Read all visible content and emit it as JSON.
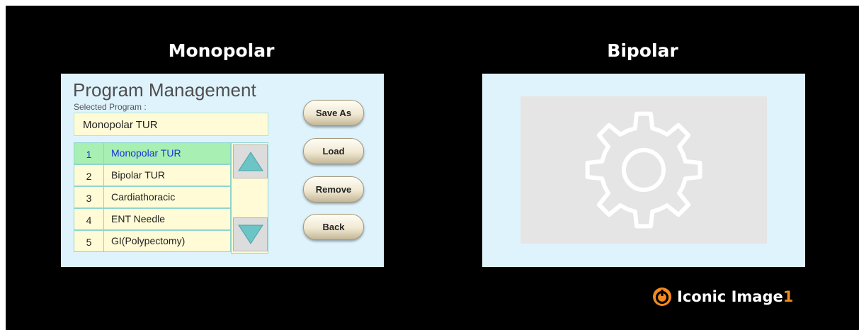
{
  "monopolar": {
    "heading": "Monopolar",
    "title": "Program Management",
    "selected_label": "Selected Program :",
    "selected_value": "Monopolar TUR",
    "programs": [
      {
        "num": "1",
        "name": "Monopolar TUR",
        "active": true
      },
      {
        "num": "2",
        "name": "Bipolar TUR",
        "active": false
      },
      {
        "num": "3",
        "name": "Cardiathoracic",
        "active": false
      },
      {
        "num": "4",
        "name": "ENT Needle",
        "active": false
      },
      {
        "num": "5",
        "name": "GI(Polypectomy)",
        "active": false
      }
    ],
    "buttons": {
      "save_as": "Save As",
      "load": "Load",
      "remove": "Remove",
      "back": "Back"
    },
    "icons": {
      "scroll_up": "triangle-up-icon",
      "scroll_down": "triangle-down-icon"
    },
    "colors": {
      "panel": "#dff3fd",
      "row": "#fffbd6",
      "active_row": "#a7efb3",
      "active_text": "#1b33d9",
      "arrow": "#6cc4c6"
    }
  },
  "bipolar": {
    "heading": "Bipolar",
    "placeholder_icon": "gear-icon"
  },
  "logo": {
    "text": "Iconic Image",
    "number": "1",
    "accent_color": "#f28a1e"
  }
}
